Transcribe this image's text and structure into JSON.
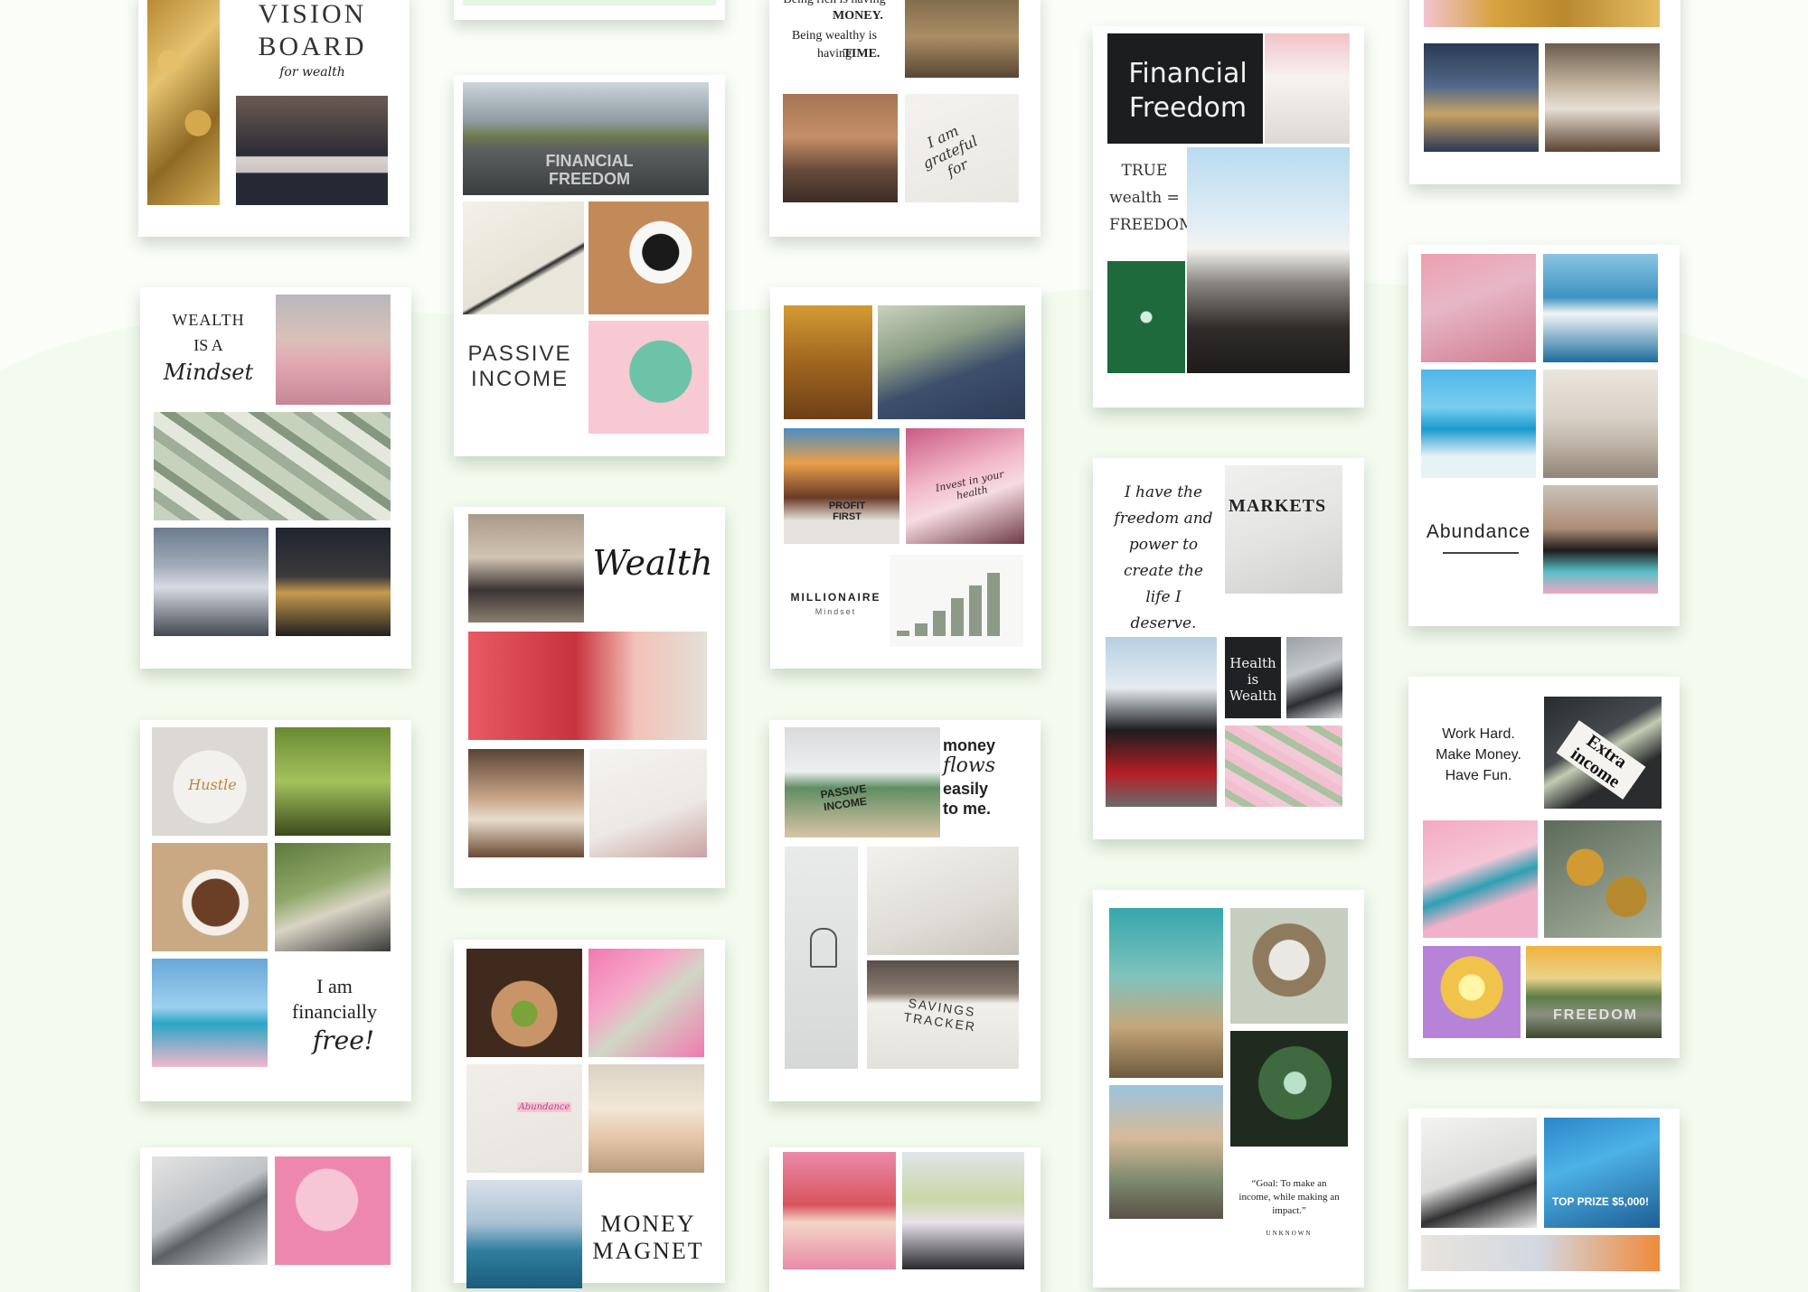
{
  "boards": {
    "vision": {
      "title": "VISION BOARD",
      "subtitle": "for wealth"
    },
    "passive": {
      "road_text": "FINANCIAL FREEDOM",
      "title": "PASSIVE INCOME"
    },
    "rich": {
      "quote_a": "Being rich is having",
      "quote_b": "MONEY.",
      "quote_c": "Being wealthy is having",
      "quote_d": "TIME.",
      "note": "I am grateful for"
    },
    "financial": {
      "chalk": "Financial Freedom",
      "true_text": "TRUE wealth = FREEDOM"
    },
    "wealth_mindset": {
      "line1": "WEALTH",
      "line2": "IS A",
      "line3": "Mindset"
    },
    "wealth": {
      "title": "Wealth"
    },
    "millionaire": {
      "book": "PROFIT FIRST",
      "tag": "Invest in your health",
      "title": "MILLIONAIRE",
      "sub": "Mindset"
    },
    "freedom_power": {
      "text": "I have the freedom and power to create the life I deserve.",
      "markets": "MARKETS",
      "health": "Health is Wealth"
    },
    "abundance": {
      "title": "Abundance"
    },
    "financially_free": {
      "line1": "I am",
      "line2": "financially",
      "line3": "free!",
      "mug": "Hustle"
    },
    "money_flows": {
      "laptop": "PASSIVE INCOME",
      "line1": "money",
      "line2": "flows",
      "line3": "easily",
      "line4": "to me.",
      "tracker": "SAVINGS TRACKER"
    },
    "work_hard": {
      "line1": "Work Hard.",
      "line2": "Make Money.",
      "line3": "Have Fun.",
      "note": "Extra income",
      "road": "FREEDOM"
    },
    "goal": {
      "quote": "“Goal: To make an income, while making an impact.”",
      "author": "UNKNOWN"
    },
    "magnet": {
      "title1": "MONEY",
      "title2": "MAGNET",
      "tag": "Abundance"
    },
    "lottery": {
      "prize": "TOP PRIZE $5,000!"
    }
  },
  "colors": {
    "background": "#f2fbee",
    "wave": "#e6f7df",
    "card": "#ffffff",
    "text": "#222222"
  }
}
